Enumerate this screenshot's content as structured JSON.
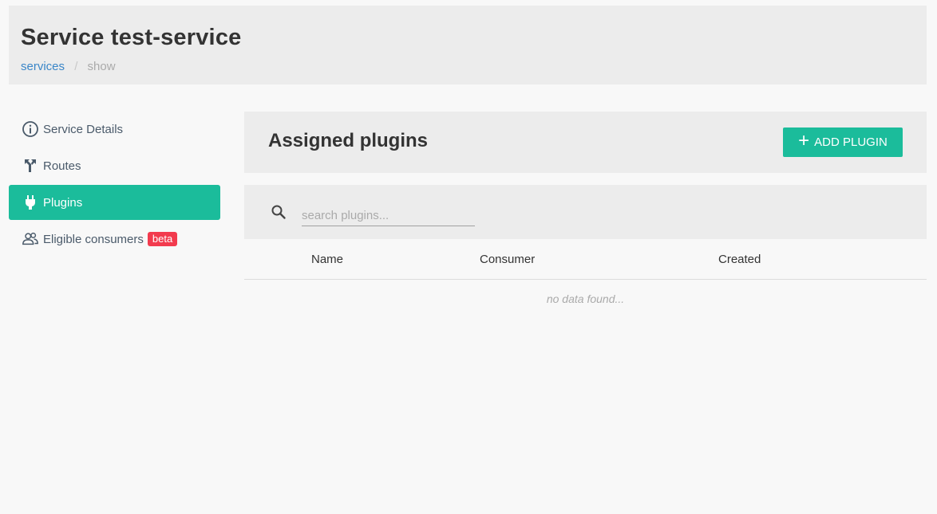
{
  "header": {
    "title": "Service test-service",
    "breadcrumb": {
      "link": "services",
      "separator": "/",
      "current": "show"
    }
  },
  "sidebar": {
    "items": [
      {
        "label": "Service Details",
        "icon": "info-icon"
      },
      {
        "label": "Routes",
        "icon": "routes-icon"
      },
      {
        "label": "Plugins",
        "icon": "plug-icon",
        "active": true
      },
      {
        "label": "Eligible consumers",
        "icon": "users-icon",
        "badge": "beta"
      }
    ]
  },
  "plugins": {
    "title": "Assigned plugins",
    "add_button_label": "ADD PLUGIN",
    "search_placeholder": "search plugins...",
    "columns": [
      "Name",
      "Consumer",
      "Created"
    ],
    "empty_text": "no data found..."
  },
  "colors": {
    "accent": "#1bbc9b",
    "link": "#3a86c8",
    "badge": "#f23b4e"
  }
}
